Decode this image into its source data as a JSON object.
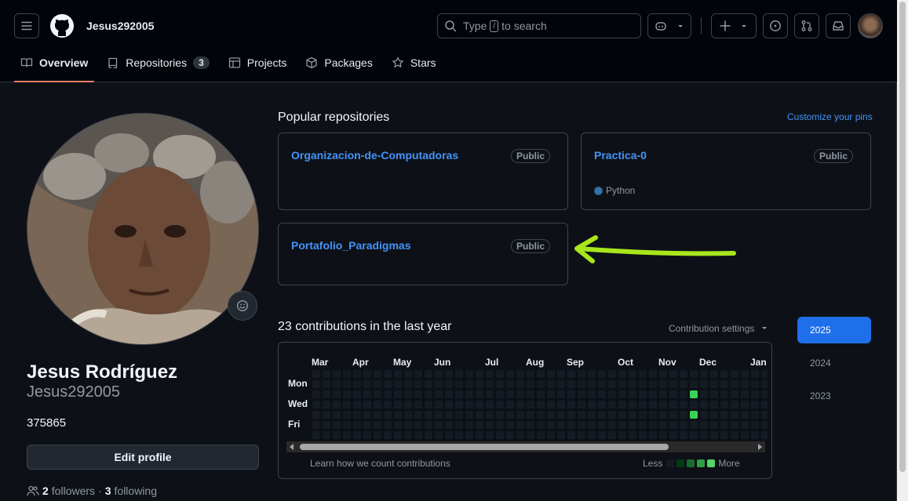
{
  "header": {
    "username": "Jesus292005",
    "search": {
      "prefix": "Type",
      "slash": "/",
      "suffix": "to search"
    }
  },
  "tabs": [
    {
      "label": "Overview",
      "icon": "book-icon",
      "active": true
    },
    {
      "label": "Repositories",
      "icon": "repo-icon",
      "count": "3"
    },
    {
      "label": "Projects",
      "icon": "table-icon"
    },
    {
      "label": "Packages",
      "icon": "package-icon"
    },
    {
      "label": "Stars",
      "icon": "star-icon"
    }
  ],
  "profile": {
    "full_name": "Jesus Rodríguez",
    "login": "Jesus292005",
    "bio": "375865",
    "edit_label": "Edit profile",
    "followers_count": "2",
    "followers_label": "followers",
    "separator": "·",
    "following_count": "3",
    "following_label": "following"
  },
  "popular": {
    "title": "Popular repositories",
    "customize_label": "Customize your pins",
    "repos": [
      {
        "name": "Organizacion-de-Computadoras",
        "visibility": "Public",
        "language": ""
      },
      {
        "name": "Practica-0",
        "visibility": "Public",
        "language": "Python"
      },
      {
        "name": "Portafolio_Paradigmas",
        "visibility": "Public",
        "language": ""
      }
    ]
  },
  "contributions": {
    "title": "23 contributions in the last year",
    "settings_label": "Contribution settings",
    "months": [
      "Mar",
      "Apr",
      "May",
      "Jun",
      "Jul",
      "Aug",
      "Sep",
      "Oct",
      "Nov",
      "Dec",
      "Jan"
    ],
    "days": [
      "Mon",
      "Wed",
      "Fri"
    ],
    "learn_label": "Learn how we count contributions",
    "less_label": "Less",
    "more_label": "More",
    "levels_colors": [
      "#151b23",
      "#033a16",
      "#196c2e",
      "#2ea043",
      "#56d364"
    ],
    "empty_color": "#151b23",
    "active_color": "#39d353"
  },
  "years": [
    "2025",
    "2024",
    "2023"
  ],
  "annotation": {
    "color": "#a8e61d"
  }
}
